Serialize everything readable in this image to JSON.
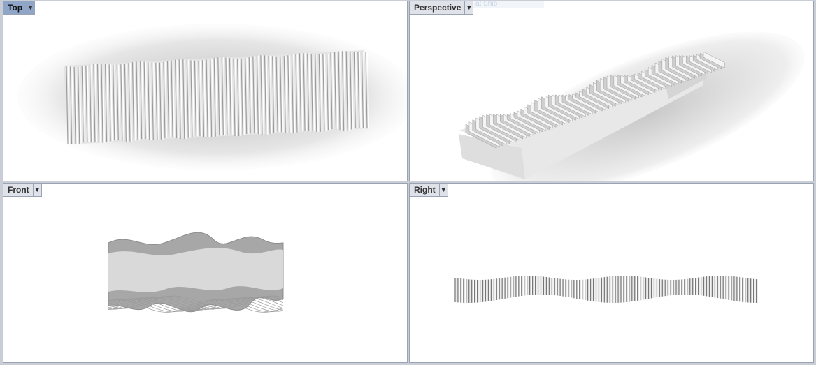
{
  "viewports": {
    "top": {
      "label": "Top",
      "active": true
    },
    "perspective": {
      "label": "Perspective",
      "active": false,
      "ghost_text": "at Ship"
    },
    "front": {
      "label": "Front",
      "active": false
    },
    "right": {
      "label": "Right",
      "active": false
    }
  },
  "icons": {
    "viewport_menu": "dropdown-arrow-icon"
  },
  "colors": {
    "active_tab": "#8fa6c9",
    "inactive_tab": "#dfe2e8",
    "viewport_bg": "#ffffff",
    "model_fill": "#d9d9d9"
  }
}
